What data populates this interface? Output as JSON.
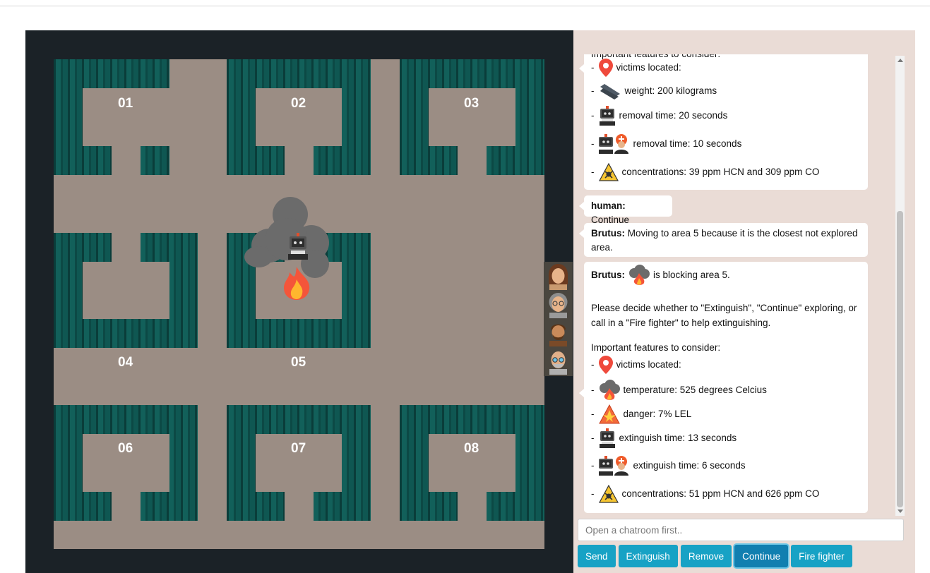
{
  "world": {
    "rooms": [
      {
        "label": "01"
      },
      {
        "label": "02"
      },
      {
        "label": "03"
      },
      {
        "label": "04"
      },
      {
        "label": "05"
      },
      {
        "label": "06"
      },
      {
        "label": "07"
      },
      {
        "label": "08"
      }
    ],
    "icons": [
      "robot-icon",
      "fire-icon",
      "smoke-icon",
      "victim-icon"
    ]
  },
  "chat": {
    "msg1": {
      "header": "Important features to consider:",
      "features": [
        {
          "icon": "location-pin-icon",
          "text": "victims located:"
        },
        {
          "icon": "steel-beam-icon",
          "text": "weight: 200 kilograms"
        },
        {
          "icon": "robot-icon",
          "text": "removal time: 20 seconds"
        },
        {
          "icon": "robot-firefighter-icon",
          "text": "removal time: 10 seconds"
        },
        {
          "icon": "toxic-warning-icon",
          "text": "concentrations: 39 ppm HCN and 309 ppm CO"
        }
      ]
    },
    "msg2": {
      "sender": "human:",
      "text": "Continue"
    },
    "msg3": {
      "sender": "Brutus:",
      "text_line1": "Moving to area 5 because it is the closest not explored",
      "text_line2": "area."
    },
    "msg4": {
      "sender": "Brutus:",
      "blocking_text": "is blocking area 5.",
      "line1": "Please decide whether to \"Extinguish\", \"Continue\" exploring, or",
      "line2": "call in a \"Fire fighter\" to help extinguishing.",
      "header": "Important features to consider:",
      "features": [
        {
          "icon": "location-pin-icon",
          "text": "victims located:"
        },
        {
          "icon": "fire-smoke-icon",
          "text": "temperature: 525 degrees Celcius"
        },
        {
          "icon": "explosion-warning-icon",
          "text": "danger: 7% LEL"
        },
        {
          "icon": "robot-icon",
          "text": "extinguish time: 13 seconds"
        },
        {
          "icon": "robot-firefighter-icon",
          "text": "extinguish time: 6 seconds"
        },
        {
          "icon": "toxic-warning-icon",
          "text": "concentrations: 51 ppm HCN and 626 ppm CO"
        }
      ]
    },
    "dash": "-"
  },
  "input": {
    "placeholder": "Open a chatroom first.."
  },
  "buttons": {
    "send": "Send",
    "extinguish": "Extinguish",
    "remove": "Remove",
    "continue": "Continue",
    "fire_fighter": "Fire fighter"
  },
  "colors": {
    "button": "#17a2c5",
    "button_active": "#117fb0",
    "wall": "#0d4f4a",
    "floor": "#9b8d84",
    "chat_bg": "#eadcd6"
  }
}
